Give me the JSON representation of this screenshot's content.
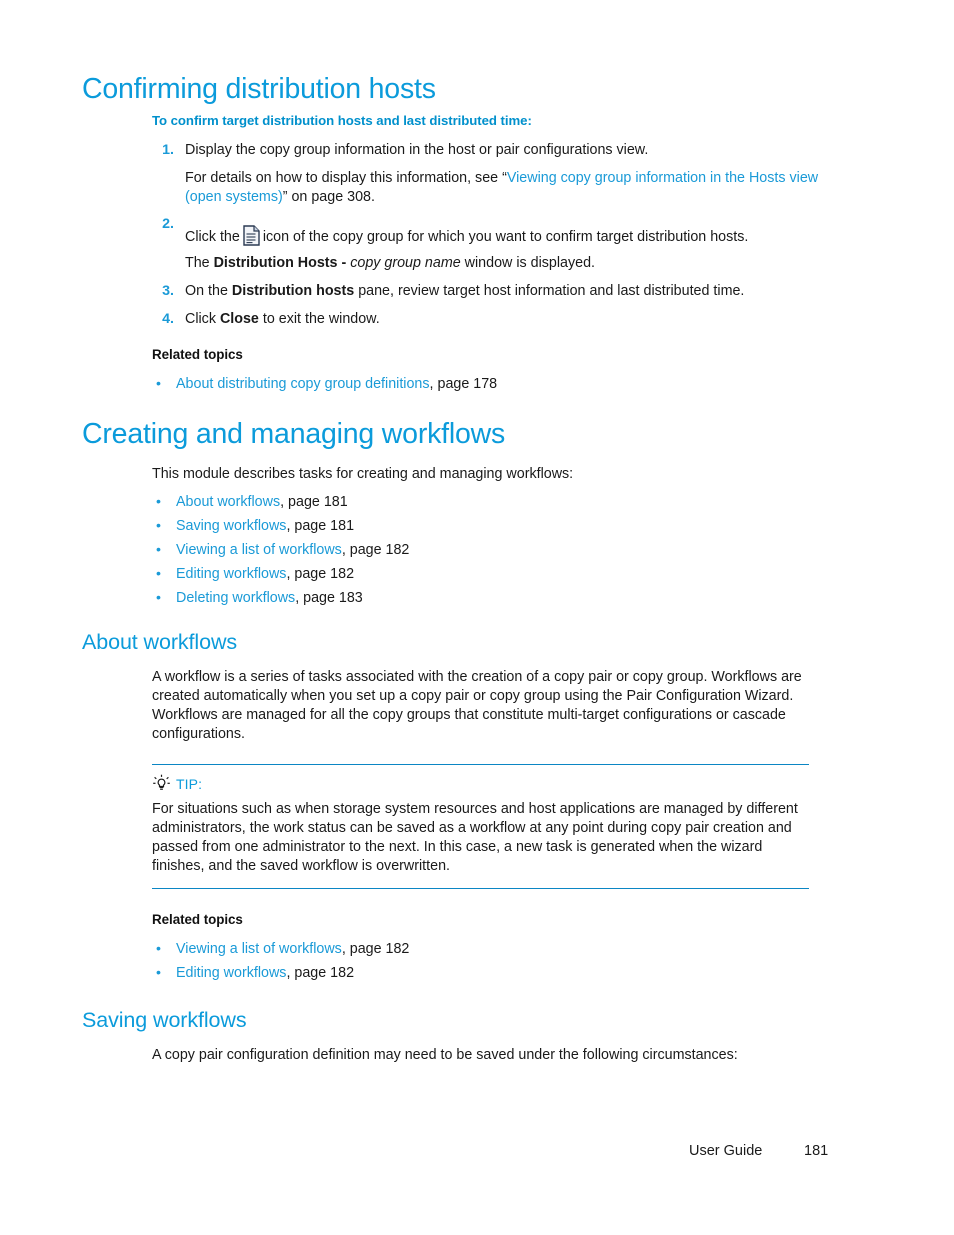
{
  "document": {
    "footer": {
      "guide_label": "User Guide",
      "page_number": "181"
    }
  },
  "section_confirming": {
    "heading": "Confirming distribution hosts",
    "procedure_heading": "To confirm target distribution hosts and last distributed time:",
    "steps": [
      {
        "number": "1.",
        "text": "Display the copy group information in the host or pair configurations view.",
        "continuation_pre": "For details on how to display this information, see “",
        "continuation_link": "Viewing copy group information in the Hosts view (open systems)",
        "continuation_post": "” on page 308."
      },
      {
        "number": "2.",
        "text_pre": "Click the",
        "icon": "document-icon",
        "text_post": "icon of the copy group for which you want to confirm target distribution hosts.",
        "result_pre": "The ",
        "result_bold": "Distribution Hosts -",
        "result_italic": " copy group name",
        "result_post": " window is displayed."
      },
      {
        "number": "3.",
        "text_pre": "On the ",
        "text_bold": "Distribution hosts",
        "text_post": " pane, review target host information and last distributed time."
      },
      {
        "number": "4.",
        "text_pre": "Click ",
        "text_bold": "Close",
        "text_post": " to exit the window."
      }
    ],
    "related_topics_heading": "Related topics",
    "related_topics": [
      {
        "bullet": "•",
        "link": "About distributing copy group definitions",
        "suffix": ", page 178"
      }
    ]
  },
  "section_creating": {
    "heading": "Creating and managing workflows",
    "intro": "This module describes tasks for creating and managing workflows:",
    "links": [
      {
        "bullet": "•",
        "link": "About workflows",
        "suffix": ", page 181"
      },
      {
        "bullet": "•",
        "link": "Saving workflows",
        "suffix": ", page 181"
      },
      {
        "bullet": "•",
        "link": "Viewing a list of workflows",
        "suffix": ", page 182"
      },
      {
        "bullet": "•",
        "link": "Editing workflows",
        "suffix": ", page 182"
      },
      {
        "bullet": "•",
        "link": "Deleting workflows",
        "suffix": ", page 183"
      }
    ]
  },
  "section_about_workflows": {
    "heading": "About workflows",
    "paragraph": "A workflow is a series of tasks associated with the creation of a copy pair or copy group.  Workflows are created automatically when you set up a copy pair or copy group using the Pair Configuration Wizard. Workflows are managed for all the copy groups that constitute multi-target configurations or cascade configurations.",
    "tip": {
      "icon": "lightbulb-tip-icon",
      "label": "TIP:",
      "body": "For situations such as when storage system resources and host applications are managed by different administrators, the work status can be saved as a workflow at any point during copy pair creation and passed from one administrator to the next. In this case, a new task is generated when the wizard finishes, and the saved workflow is overwritten."
    },
    "related_topics_heading": "Related topics",
    "related_topics": [
      {
        "bullet": "•",
        "link": "Viewing a list of workflows",
        "suffix": ", page 182"
      },
      {
        "bullet": "•",
        "link": "Editing workflows",
        "suffix": ", page 182"
      }
    ]
  },
  "section_saving_workflows": {
    "heading": "Saving workflows",
    "paragraph": "A copy pair configuration definition may need to be saved under the following circumstances:"
  },
  "colors": {
    "heading_blue": "#0b9bdb",
    "link_blue": "#1a9ad7",
    "rule_blue": "#0b86c4",
    "body_black": "#1a1a1a"
  }
}
